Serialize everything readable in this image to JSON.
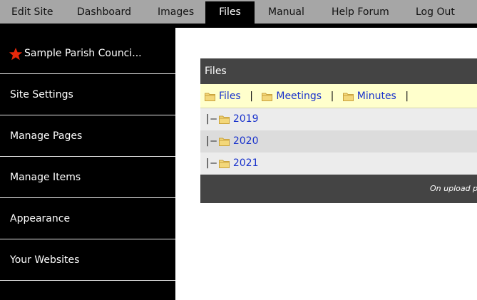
{
  "topnav": {
    "tabs": [
      {
        "label": "Edit Site"
      },
      {
        "label": "Dashboard"
      },
      {
        "label": "Images"
      },
      {
        "label": "Files"
      },
      {
        "label": "Manual"
      },
      {
        "label": "Help Forum"
      },
      {
        "label": "Log Out"
      }
    ],
    "active_tab": "Files"
  },
  "sidebar": {
    "site_name": "Sample Parish Counci...",
    "items": [
      {
        "label": "Site Settings"
      },
      {
        "label": "Manage Pages"
      },
      {
        "label": "Manage Items"
      },
      {
        "label": "Appearance"
      },
      {
        "label": "Your Websites"
      }
    ]
  },
  "files_panel": {
    "title": "Files",
    "breadcrumb": [
      {
        "label": "Files"
      },
      {
        "label": "Meetings"
      },
      {
        "label": "Minutes"
      }
    ],
    "separator": "|",
    "tree_prefix": "|—",
    "folders": [
      {
        "name": "2019"
      },
      {
        "name": "2020"
      },
      {
        "name": "2021"
      }
    ],
    "footer_note": "On upload p"
  },
  "colors": {
    "nav_bg": "#a6a6a6",
    "active_tab_bg": "#000000",
    "sidebar_bg": "#000000",
    "panel_header_bg": "#444444",
    "breadcrumb_bg": "#ffffcc",
    "link": "#1a33cc",
    "star": "#e8290b"
  },
  "icons": {
    "site": "star-icon",
    "folder": "folder-icon"
  }
}
